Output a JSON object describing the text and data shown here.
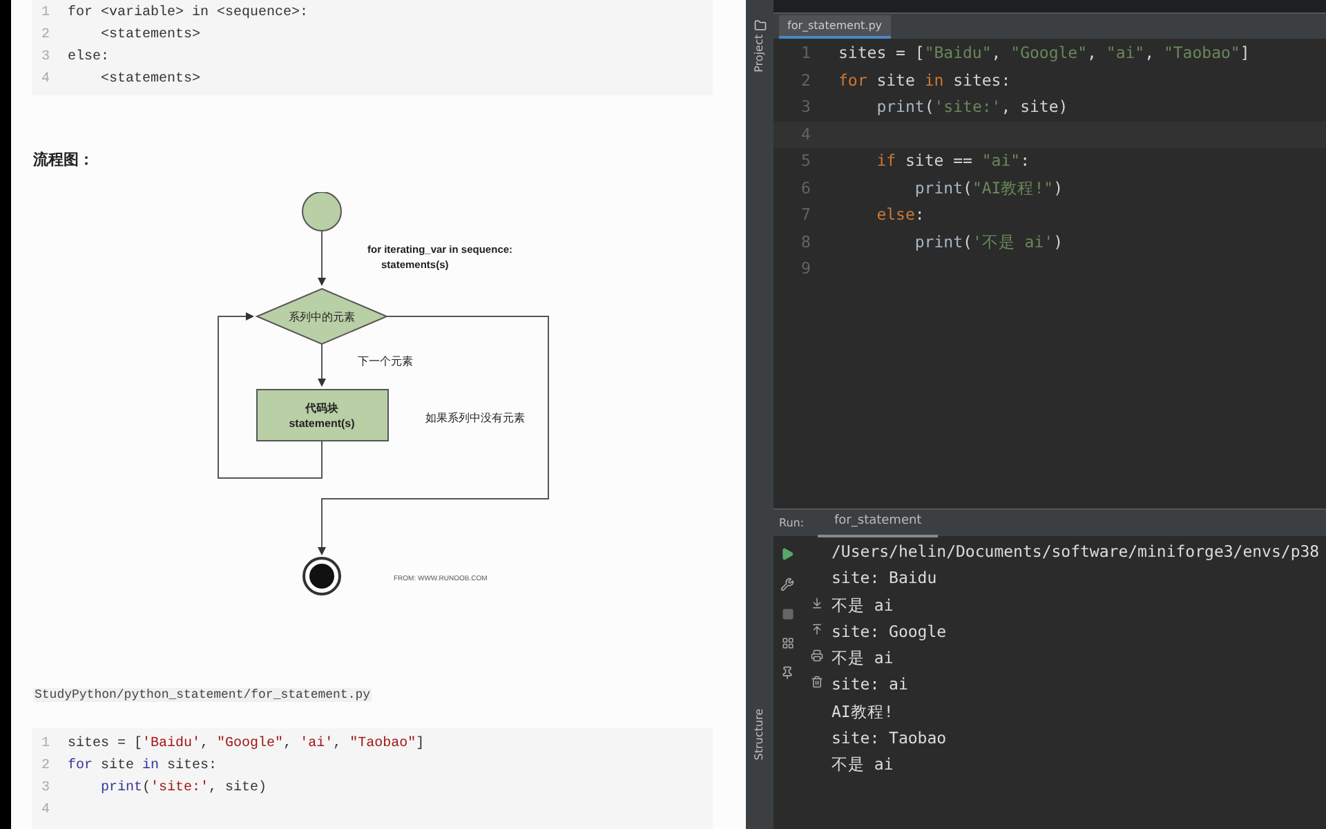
{
  "doc": {
    "syntax_block": {
      "lines": [
        {
          "number": "1",
          "tokens": [
            {
              "text": "for <variable> in <sequence>:",
              "kind": "plain"
            }
          ]
        },
        {
          "number": "2",
          "tokens": [
            {
              "text": "    <statements>",
              "kind": "plain"
            }
          ]
        },
        {
          "number": "3",
          "tokens": [
            {
              "text": "else:",
              "kind": "plain"
            }
          ]
        },
        {
          "number": "4",
          "tokens": [
            {
              "text": "    <statements>",
              "kind": "plain"
            }
          ]
        }
      ]
    },
    "flowchart_heading": "流程图：",
    "flowchart": {
      "loop_label": "for iterating_var in sequence:",
      "loop_body": "statements(s)",
      "decision": "系列中的元素",
      "next_label": "下一个元素",
      "block_title": "代码块",
      "block_body": "statement(s)",
      "exit_label": "如果系列中没有元素",
      "source": "FROM: WWW.RUNOOB.COM"
    },
    "file_path": "StudyPython/python_statement/for_statement.py",
    "example_block": {
      "lines": [
        {
          "number": "1",
          "tokens": [
            {
              "text": "sites = [",
              "kind": "plain"
            },
            {
              "text": "'Baidu'",
              "kind": "str"
            },
            {
              "text": ", ",
              "kind": "plain"
            },
            {
              "text": "\"Google\"",
              "kind": "str"
            },
            {
              "text": ", ",
              "kind": "plain"
            },
            {
              "text": "'ai'",
              "kind": "str"
            },
            {
              "text": ", ",
              "kind": "plain"
            },
            {
              "text": "\"Taobao\"",
              "kind": "str"
            },
            {
              "text": "]",
              "kind": "plain"
            }
          ]
        },
        {
          "number": "2",
          "tokens": [
            {
              "text": "for",
              "kind": "kw"
            },
            {
              "text": " site ",
              "kind": "plain"
            },
            {
              "text": "in",
              "kind": "kw"
            },
            {
              "text": " sites:",
              "kind": "plain"
            }
          ]
        },
        {
          "number": "3",
          "tokens": [
            {
              "text": "    print",
              "kind": "fn"
            },
            {
              "text": "(",
              "kind": "plain"
            },
            {
              "text": "'site:'",
              "kind": "str"
            },
            {
              "text": ", site)",
              "kind": "plain"
            }
          ]
        },
        {
          "number": "4"
        }
      ]
    }
  },
  "ide": {
    "side_tab": "Project",
    "file_tab": "for_statement.py",
    "editor": {
      "lines": [
        {
          "number": "1",
          "tokens": [
            {
              "text": "sites = [",
              "kind": "plain"
            },
            {
              "text": "\"Baidu\"",
              "kind": "str"
            },
            {
              "text": ", ",
              "kind": "plain"
            },
            {
              "text": "\"Google\"",
              "kind": "str"
            },
            {
              "text": ", ",
              "kind": "plain"
            },
            {
              "text": "\"ai\"",
              "kind": "str"
            },
            {
              "text": ", ",
              "kind": "plain"
            },
            {
              "text": "\"Taobao\"",
              "kind": "str"
            },
            {
              "text": "]",
              "kind": "plain"
            }
          ]
        },
        {
          "number": "2",
          "tokens": [
            {
              "text": "for",
              "kind": "kw"
            },
            {
              "text": " site ",
              "kind": "plain"
            },
            {
              "text": "in",
              "kind": "kw"
            },
            {
              "text": " sites:",
              "kind": "plain"
            }
          ]
        },
        {
          "number": "3",
          "tokens": [
            {
              "text": "    print",
              "kind": "fn"
            },
            {
              "text": "(",
              "kind": "plain"
            },
            {
              "text": "'site:'",
              "kind": "str"
            },
            {
              "text": ", site)",
              "kind": "plain"
            }
          ]
        },
        {
          "number": "4"
        },
        {
          "number": "5",
          "tokens": [
            {
              "text": "    if",
              "kind": "kw"
            },
            {
              "text": " site == ",
              "kind": "plain"
            },
            {
              "text": "\"ai\"",
              "kind": "str"
            },
            {
              "text": ":",
              "kind": "plain"
            }
          ]
        },
        {
          "number": "6",
          "tokens": [
            {
              "text": "        print",
              "kind": "fn"
            },
            {
              "text": "(",
              "kind": "plain"
            },
            {
              "text": "\"AI教程!\"",
              "kind": "str"
            },
            {
              "text": ")",
              "kind": "plain"
            }
          ]
        },
        {
          "number": "7",
          "tokens": [
            {
              "text": "    else",
              "kind": "kw"
            },
            {
              "text": ":",
              "kind": "plain"
            }
          ]
        },
        {
          "number": "8",
          "tokens": [
            {
              "text": "        print",
              "kind": "fn"
            },
            {
              "text": "(",
              "kind": "plain"
            },
            {
              "text": "'不是 ai'",
              "kind": "str"
            },
            {
              "text": ")",
              "kind": "plain"
            }
          ]
        },
        {
          "number": "9"
        }
      ]
    },
    "run": {
      "label": "Run:",
      "tab": "for_statement",
      "output": [
        "/Users/helin/Documents/software/miniforge3/envs/p38",
        "site: Baidu",
        "不是 ai",
        "site: Google",
        "不是 ai",
        "site: ai",
        "AI教程!",
        "site: Taobao",
        "不是 ai"
      ]
    },
    "structure_tab": "Structure"
  }
}
